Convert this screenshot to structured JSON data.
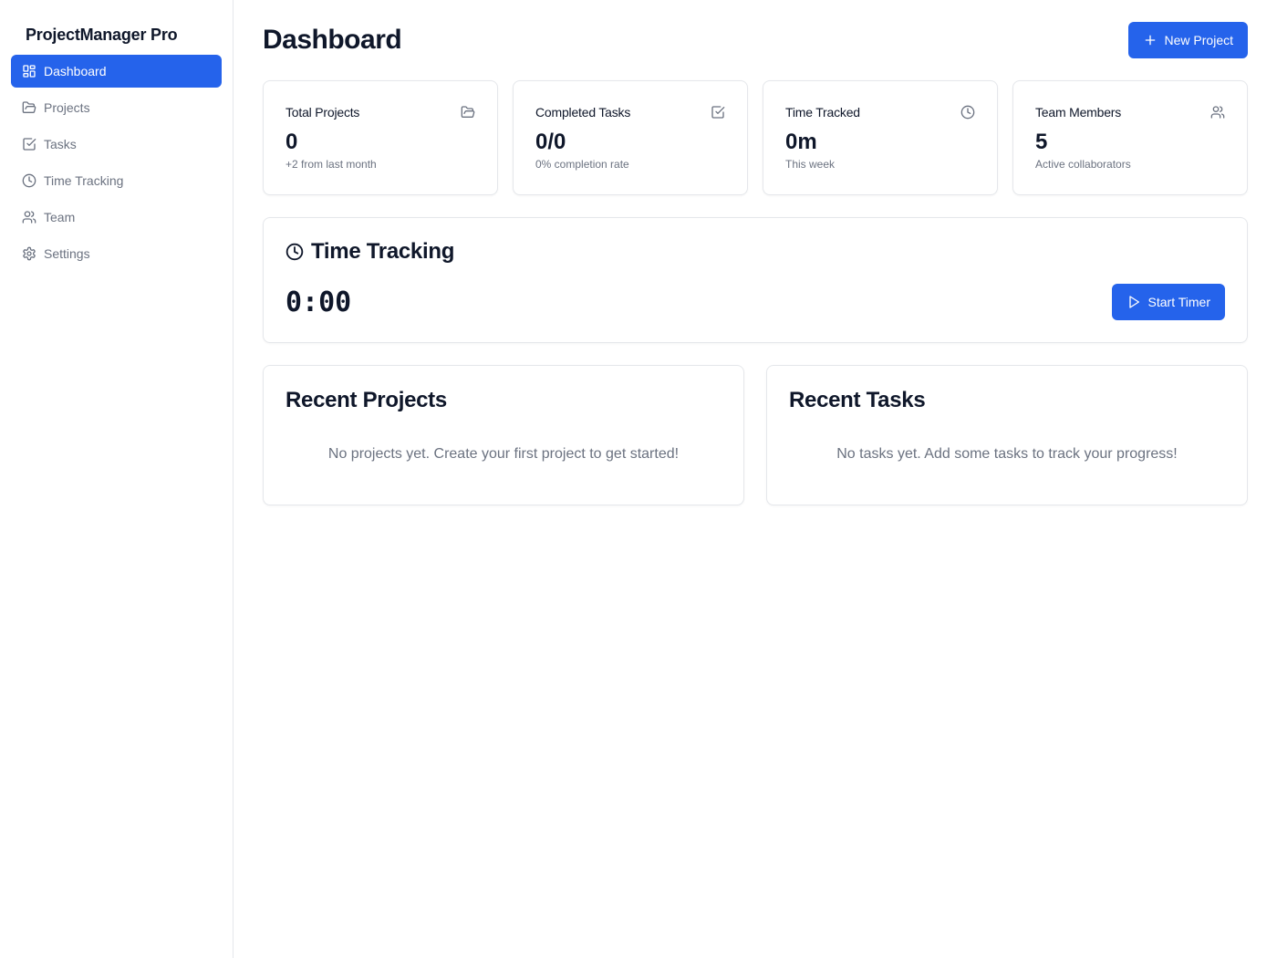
{
  "sidebar": {
    "brand": "ProjectManager Pro",
    "items": [
      {
        "label": "Dashboard",
        "icon": "layout-dashboard-icon",
        "active": true
      },
      {
        "label": "Projects",
        "icon": "folder-open-icon"
      },
      {
        "label": "Tasks",
        "icon": "check-square-icon"
      },
      {
        "label": "Time Tracking",
        "icon": "clock-icon"
      },
      {
        "label": "Team",
        "icon": "users-icon"
      },
      {
        "label": "Settings",
        "icon": "settings-icon"
      }
    ]
  },
  "header": {
    "title": "Dashboard",
    "new_project_label": "New Project"
  },
  "stats": [
    {
      "label": "Total Projects",
      "value": "0",
      "sub": "+2 from last month",
      "icon": "folder-open-icon"
    },
    {
      "label": "Completed Tasks",
      "value": "0/0",
      "sub": "0% completion rate",
      "icon": "check-square-icon"
    },
    {
      "label": "Time Tracked",
      "value": "0m",
      "sub": "This week",
      "icon": "clock-icon"
    },
    {
      "label": "Team Members",
      "value": "5",
      "sub": "Active collaborators",
      "icon": "users-icon"
    }
  ],
  "time_tracking": {
    "title": "Time Tracking",
    "timer": "0:00",
    "start_label": "Start Timer"
  },
  "recent_projects": {
    "title": "Recent Projects",
    "empty": "No projects yet. Create your first project to get started!"
  },
  "recent_tasks": {
    "title": "Recent Tasks",
    "empty": "No tasks yet. Add some tasks to track your progress!"
  },
  "colors": {
    "accent": "#2563eb",
    "muted_text": "#6b7280",
    "border": "#e5e7eb",
    "text": "#0f172a"
  }
}
